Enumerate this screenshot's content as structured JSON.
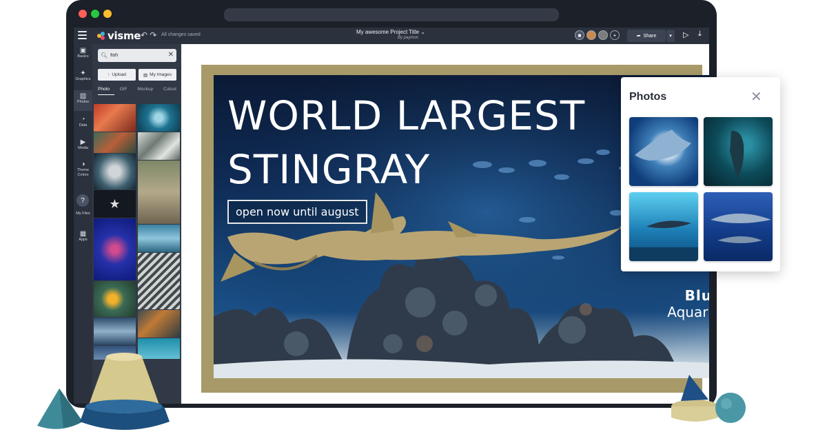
{
  "app": {
    "logo_text": "visme",
    "saved_status": "All changes saved",
    "project_title": "My awesome Project Title",
    "project_by": "By paymon",
    "share_label": "Share"
  },
  "rail": {
    "items": [
      {
        "label": "Basics",
        "icon": "basics-icon"
      },
      {
        "label": "Graphics",
        "icon": "graphics-icon"
      },
      {
        "label": "Photos",
        "icon": "photos-icon"
      },
      {
        "label": "Data",
        "icon": "data-icon"
      },
      {
        "label": "Media",
        "icon": "media-icon"
      },
      {
        "label": "Theme Colors",
        "icon": "theme-icon"
      },
      {
        "label": "My Files",
        "icon": "files-icon"
      },
      {
        "label": "Apps",
        "icon": "apps-icon"
      }
    ],
    "help": "?"
  },
  "panel": {
    "search_value": "fish",
    "upload_label": "Upload",
    "myimages_label": "My Images",
    "tabs": [
      "Photo",
      "GIF",
      "Mockup",
      "Cutout"
    ]
  },
  "slide": {
    "title_line1": "WORLD LARGEST",
    "title_line2": "STINGRAY",
    "subtitle": "open now until august",
    "brand_line1": "Blu",
    "brand_line2": "Aquari"
  },
  "photos_popup": {
    "title": "Photos"
  },
  "colors": {
    "frame": "#1b2029",
    "topbar": "#2b313d",
    "slide_border": "#a89a68",
    "dot_red": "#ff5f57",
    "dot_yellow": "#febc2e",
    "dot_green": "#28c840"
  }
}
